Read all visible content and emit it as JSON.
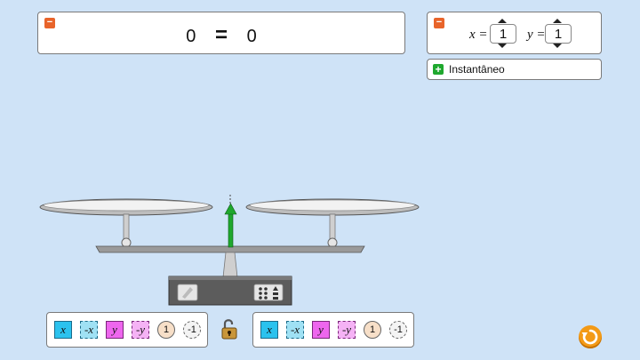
{
  "equation": {
    "left": "0",
    "sign": "=",
    "right": "0"
  },
  "variables": {
    "x": {
      "label": "x =",
      "value": "1"
    },
    "y": {
      "label": "y =",
      "value": "1"
    }
  },
  "snapshot": {
    "label": "Instantâneo"
  },
  "toolbox_left": {
    "tiles": [
      {
        "kind": "x",
        "label": "x"
      },
      {
        "kind": "nx",
        "label": "-x"
      },
      {
        "kind": "y",
        "label": "y"
      },
      {
        "kind": "ny",
        "label": "-y"
      },
      {
        "kind": "one",
        "label": "1"
      },
      {
        "kind": "none",
        "label": "-1"
      }
    ]
  },
  "toolbox_right": {
    "tiles": [
      {
        "kind": "x",
        "label": "x"
      },
      {
        "kind": "nx",
        "label": "-x"
      },
      {
        "kind": "y",
        "label": "y"
      },
      {
        "kind": "ny",
        "label": "-y"
      },
      {
        "kind": "one",
        "label": "1"
      },
      {
        "kind": "none",
        "label": "-1"
      }
    ]
  },
  "colors": {
    "background": "#cfe3f7",
    "collapse": "#e8642a",
    "expand": "#1fa82e",
    "balance_arrow": "#1fa82e",
    "tile_x": "#2bc2ee",
    "tile_y": "#ee66ee",
    "reset": "#f39a16"
  },
  "icons": {
    "collapse": "minus-icon",
    "expand": "plus-icon",
    "lock": "unlocked-padlock-icon",
    "reset": "reset-icon"
  }
}
